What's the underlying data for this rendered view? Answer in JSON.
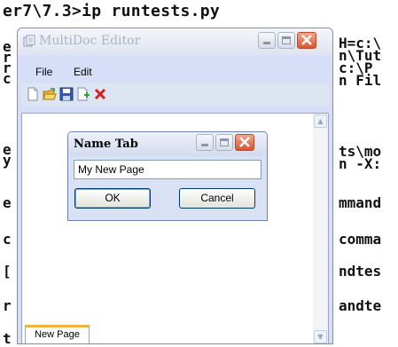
{
  "console": {
    "title_line": "er7\\7.3>ip runtests.py",
    "left_chars": [
      "e",
      "r",
      "r",
      "c",
      "e",
      "y",
      "e",
      "c",
      "[",
      "r",
      "t"
    ],
    "right_fragments": [
      "H=c:\\",
      "n\\Tut",
      "c:\\P",
      "n Fil",
      "ts\\mo",
      "n -X:",
      "mmand",
      "comma",
      "ndtes",
      "andte"
    ]
  },
  "window": {
    "title": "MultiDoc Editor",
    "menu": [
      "File",
      "Edit"
    ],
    "toolbar_icons": [
      "new-document-icon",
      "open-folder-icon",
      "save-disk-icon",
      "add-page-icon",
      "delete-x-icon"
    ],
    "tab_label": "New Page"
  },
  "dialog": {
    "title": "Name Tab",
    "input_value": "My New Page",
    "ok_label": "OK",
    "cancel_label": "Cancel"
  },
  "colors": {
    "close_button": "#d9562f",
    "tab_accent": "#f2b13c",
    "toolbar_delete": "#d42020"
  }
}
